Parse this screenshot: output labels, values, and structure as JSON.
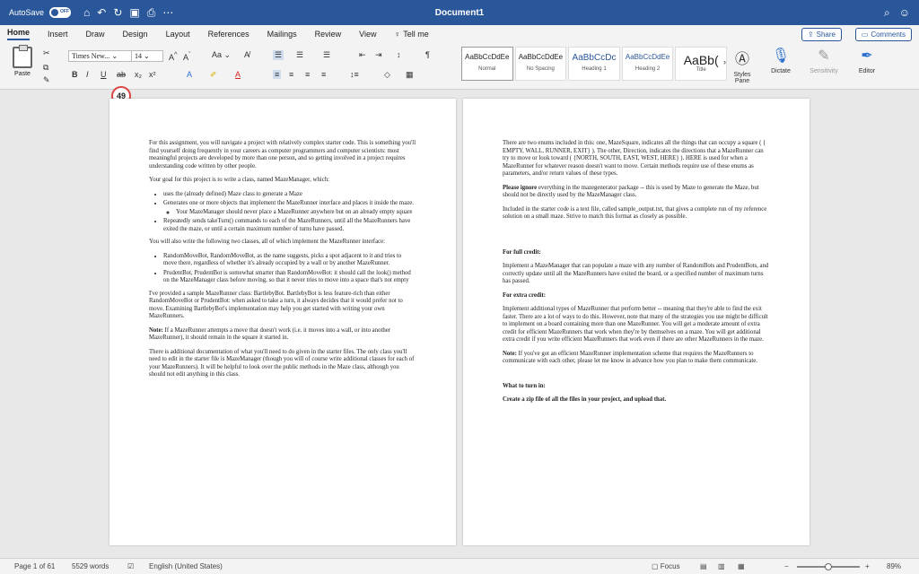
{
  "titlebar": {
    "autosave_label": "AutoSave",
    "autosave_state": "OFF",
    "doc_title": "Document1"
  },
  "tabs": [
    "Home",
    "Insert",
    "Draw",
    "Design",
    "Layout",
    "References",
    "Mailings",
    "Review",
    "View"
  ],
  "tell_me": "Tell me",
  "share": "Share",
  "comments": "Comments",
  "ribbon": {
    "paste": "Paste",
    "font": "Times New...",
    "size": "14",
    "styles": [
      {
        "sample": "AaBbCcDdEe",
        "name": "Normal"
      },
      {
        "sample": "AaBbCcDdEe",
        "name": "No Spacing"
      },
      {
        "sample": "AaBbCcDc",
        "name": "Heading 1"
      },
      {
        "sample": "AaBbCcDdEe",
        "name": "Heading 2"
      },
      {
        "sample": "AaBb(",
        "name": "Title"
      }
    ],
    "styles_pane": "Styles Pane",
    "dictate": "Dictate",
    "sensitivity": "Sensitivity",
    "editor": "Editor"
  },
  "badge": "49",
  "page1": {
    "p1": "For this assignment, you will navigate a project with relatively complex starter code. This is something you'll find yourself doing frequently in your careers as computer programmers and computer scientists: most meaningful projects are developed by more than one person, and so getting involved in a project requires understanding code written by other people.",
    "p2": "Your goal for this project is to write a class, named MazeManager, which:",
    "b1": "uses the (already defined) Maze class to generate a Maze",
    "b2": "Generates one or more objects that implement the MazeRunner interface and places it inside the maze.",
    "b2a": "Your MazeManager should never place a MazeRunner anywhere but on an already empty square",
    "b3": "Repeatedly sends takeTurn() commands to each of the MazeRunners, until all the MazeRunners have exited the maze, or until a certain maximum number of turns have passed.",
    "p3": "You will also write the following two classes, all of which implement the MazeRunner interface:",
    "b4": "RandomMoveBot, RandomMoveBot, as the name suggests, picks a spot adjacent to it and tries to move there, regardless of whether it's already occupied by a wall or by another MazeRunner.",
    "b5": "PrudentBot, PrudentBot is somewhat smarter than RandomMoveBot: it should call the look() method on the MazeManager class before moving, so that it never tries to move into a space that's not empty",
    "p4": "I've provided a sample MazeRunner class: BartlebyBot. BartlebyBot is less feature-rich than either RandomMoveBot or PrudentBot: when asked to take a turn, it always decides that it would prefer not to move. Examining BartlebyBot's implementation may help you get started with writing your own MazeRunners.",
    "p5_bold": "Note:",
    "p5": " If a MazeRunner attempts a move that doesn't work (i.e. it moves into a wall, or into another MazeRunner), it should remain in the square it started in.",
    "p6": "There is additional documentation of what you'll need to do given in the starter files. The only class you'll need to edit in the starter file is MazeManager (though you will of course write additional classes for each of your MazeRunners). It will be helpful to look over the public methods in the Maze class, although you should not edit anything in this class."
  },
  "page2": {
    "p1": "There are two enums included in this: one, MazeSquare, indicates all the things that can occupy a square ( { EMPTY, WALL, RUNNER, EXIT} ). The other, Direction, indicates the directions that a MazeRunner can try to move or look toward ( {NORTH, SOUTH, EAST, WEST, HERE} ). HERE is used for when a MazeRunner for whatever reason doesn't want to move. Certain methods require use of these enums as parameters, and/or return values of these types.",
    "p2_bold": "Please ignore",
    "p2": " everything in the mazegenerator package -- this is used by Maze to generate the Maze, but should not be directly used by the MazeManager class.",
    "p3": "Included in the starter code is a text file, called sample_output.txt, that gives a complete run of my reference solution on a small maze. Strive to match this format as closely as possible.",
    "h1": "For full credit:",
    "p4": "Implement a MazeManager that can populate a maze with any number of RandomBots and PrudentBots, and correctly update until all the MazeRunners have exited the board, or a specified number of maximum turns has passed.",
    "h2": "For extra credit:",
    "p5": "Implement additional types of MazeRunner that perform better -- meaning that they're able to find the exit faster. There are a lot of ways to do this. However, note that many of the strategies you use might be difficult to implement on a board containing more than one MazeRunner. You will get a moderate amount of extra credit for efficient MazeRunners that work when they're by themselves on a maze. You will get additional extra credit if you write efficient MazeRunners that work even if there are other MazeRunners in the maze.",
    "p6_bold": "Note:",
    "p6": " If you've got an efficient MazeRunner implementation scheme that requires the MazeRunners to communicate with each other, please let me know in advance how you plan to make them communicate.",
    "h3": "What to turn in:",
    "h4": "Create a zip file of all the files in your project, and upload that."
  },
  "statusbar": {
    "page": "Page 1 of 61",
    "words": "5529 words",
    "language": "English (United States)",
    "focus": "Focus",
    "zoom": "89%"
  },
  "zoom_fraction": 0.5
}
